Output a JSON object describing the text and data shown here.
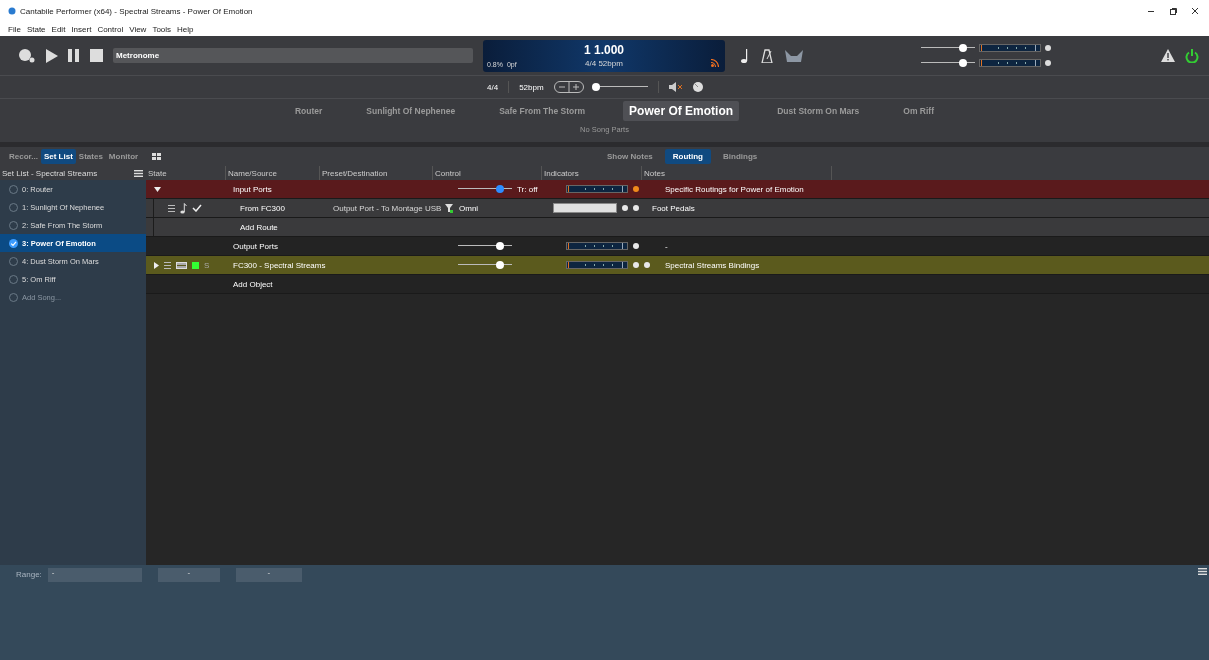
{
  "window": {
    "title": "Cantabile Performer (x64) - Spectral Streams - Power Of Emotion"
  },
  "menu": [
    "File",
    "State",
    "Edit",
    "Insert",
    "Control",
    "View",
    "Tools",
    "Help"
  ],
  "toolbar": {
    "metronome_label": "Metronome",
    "display": {
      "position": "1 1.000",
      "load": "0.8%",
      "offset": "0pf",
      "meter": "4/4 52bpm"
    },
    "master_sliders": [
      {
        "level": 0.78
      },
      {
        "level": 0.78
      }
    ]
  },
  "tempo_bar": {
    "time_signature": "4/4",
    "tempo": "52bpm",
    "tempo_slider": {
      "level": 0.05
    }
  },
  "songs": [
    {
      "label": "Router",
      "selected": false
    },
    {
      "label": "Sunlight Of Nephenee",
      "selected": false
    },
    {
      "label": "Safe From The Storm",
      "selected": false
    },
    {
      "label": "Power Of Emotion",
      "selected": true
    },
    {
      "label": "Dust Storm On Mars",
      "selected": false
    },
    {
      "label": "Om Riff",
      "selected": false
    }
  ],
  "song_parts_note": "No Song Parts",
  "side_tabs": [
    {
      "label": "Recor...",
      "selected": false
    },
    {
      "label": "Set List",
      "selected": true
    },
    {
      "label": "States",
      "selected": false
    },
    {
      "label": "Monitor",
      "selected": false
    }
  ],
  "set_list": {
    "title": "Set List - Spectral Streams",
    "items": [
      {
        "kind": "song",
        "label": "0: Router",
        "selected": false
      },
      {
        "kind": "song",
        "label": "1: Sunlight Of Nephenee",
        "selected": false
      },
      {
        "kind": "song",
        "label": "2: Safe From The Storm",
        "selected": false
      },
      {
        "kind": "song",
        "label": "3: Power Of Emotion",
        "selected": true
      },
      {
        "kind": "song",
        "label": "4: Dust Storm On Mars",
        "selected": false
      },
      {
        "kind": "song",
        "label": "5: Om Riff",
        "selected": false
      },
      {
        "kind": "add",
        "label": "Add Song...",
        "selected": false
      }
    ]
  },
  "view_tabs": [
    {
      "label": "Show Notes",
      "selected": false
    },
    {
      "label": "Routing",
      "selected": true
    },
    {
      "label": "Bindings",
      "selected": false
    }
  ],
  "table": {
    "columns": [
      "State",
      "Name/Source",
      "Preset/Destination",
      "Control",
      "Indicators",
      "Notes"
    ],
    "rows": [
      {
        "kind": "group",
        "name": "Input Ports",
        "expanded": true,
        "slider": {
          "level": 0.78,
          "active": true
        },
        "control": "Tr: off",
        "meter": true,
        "dots": [
          {
            "color": "#f08a1c"
          }
        ],
        "notes": "Specific Routings for Power of Emotion"
      },
      {
        "kind": "route",
        "name": "From FC300",
        "preset": "Output Port - To Montage USB",
        "control": "Omni",
        "dots": [
          {
            "color": "#e8e8e8"
          },
          {
            "color": "#e8e8e8"
          }
        ],
        "notes": "Foot Pedals"
      },
      {
        "kind": "action",
        "name": "Add Route"
      },
      {
        "kind": "group",
        "name": "Output Ports",
        "slider": {
          "level": 0.78,
          "active": false
        },
        "meter": true,
        "dots": [
          {
            "color": "#e8e8e8"
          }
        ],
        "notes": "-"
      },
      {
        "kind": "object",
        "name": "FC300 - Spectral Streams",
        "expanded": false,
        "solo_label": "S",
        "slider": {
          "level": 0.78,
          "active": false
        },
        "meter": true,
        "dots": [
          {
            "color": "#e8e8e8"
          },
          {
            "color": "#e8e8e8"
          }
        ],
        "notes": "Spectral Streams Bindings"
      },
      {
        "kind": "action",
        "name": "Add Object"
      }
    ]
  },
  "footer": {
    "range_label": "Range:",
    "range_value": "-",
    "fields": [
      "-",
      "-"
    ]
  }
}
